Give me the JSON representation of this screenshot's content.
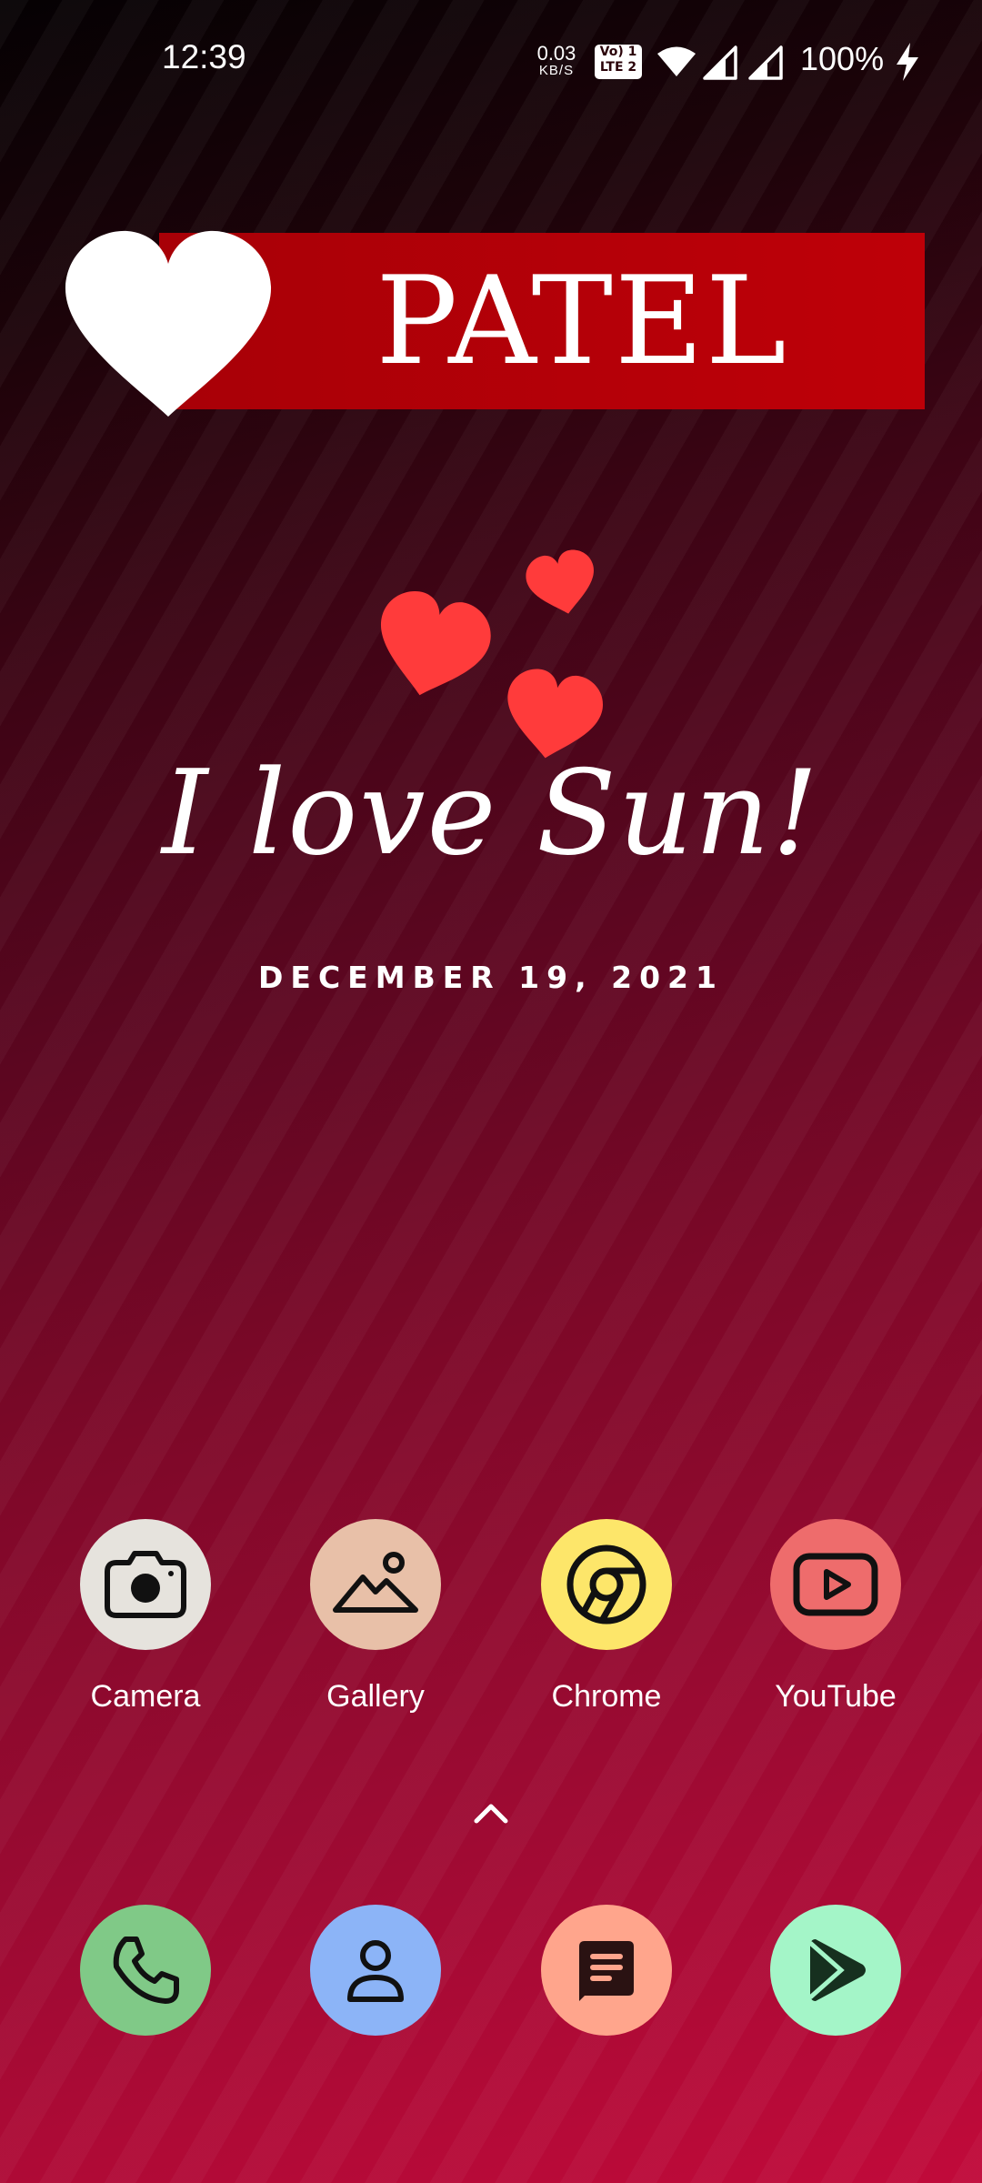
{
  "status_bar": {
    "time": "12:39",
    "net_speed_value": "0.03",
    "net_speed_unit": "KB/S",
    "volte_line1": "Vo) 1",
    "volte_line2": "LTE 2",
    "battery": "100%",
    "icons": [
      "wifi-icon",
      "signal-icon",
      "signal-icon",
      "charging-icon"
    ]
  },
  "widget": {
    "name": "PATEL",
    "message": "I love Sun!",
    "date": "DECEMBER 19, 2021",
    "colors": {
      "banner_red": "#b80008",
      "heart_red": "#ff3b3b"
    }
  },
  "apps": [
    {
      "label": "Camera",
      "icon": "camera-icon",
      "color": "#e6e3dd"
    },
    {
      "label": "Gallery",
      "icon": "gallery-icon",
      "color": "#e8c0a8"
    },
    {
      "label": "Chrome",
      "icon": "chrome-icon",
      "color": "#fde66a"
    },
    {
      "label": "YouTube",
      "icon": "youtube-icon",
      "color": "#ee6c6c"
    }
  ],
  "dock": [
    {
      "icon": "phone-icon",
      "color": "#80c987"
    },
    {
      "icon": "contacts-icon",
      "color": "#8cb4f7"
    },
    {
      "icon": "messages-icon",
      "color": "#ffa58c"
    },
    {
      "icon": "play-store-icon",
      "color": "#a4f5c8"
    }
  ],
  "drawer_hint_icon": "chevron-up-icon"
}
